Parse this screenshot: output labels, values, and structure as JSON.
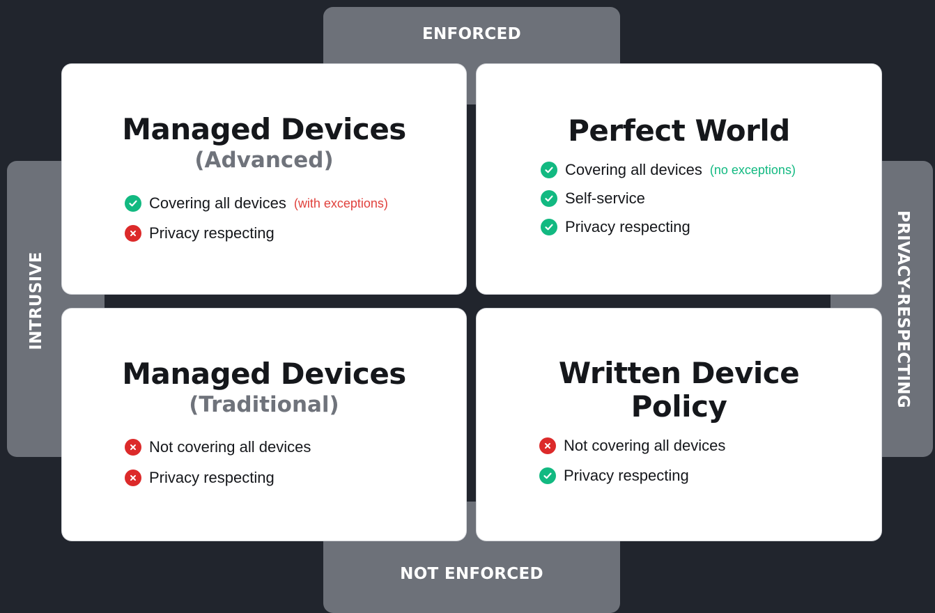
{
  "colors": {
    "background": "#21252d",
    "band": "#6d7179",
    "card": "#ffffff",
    "check": "#12b981",
    "cross": "#dc2a2a",
    "note_red": "#e0413c",
    "note_green": "#12b981"
  },
  "axes": {
    "top": "ENFORCED",
    "bottom": "NOT ENFORCED",
    "left": "INTRUSIVE",
    "right": "PRIVACY-RESPECTING"
  },
  "quadrants": {
    "top_left": {
      "title": "Managed Devices",
      "subtitle": "(Advanced)",
      "items": [
        {
          "status": "check",
          "icon": "check-circle-icon",
          "text": "Covering all devices",
          "note": "(with exceptions)"
        },
        {
          "status": "cross",
          "icon": "x-circle-icon",
          "text": "Privacy respecting"
        }
      ]
    },
    "top_right": {
      "title": "Perfect World",
      "items": [
        {
          "status": "check",
          "icon": "check-circle-icon",
          "text": "Covering all devices",
          "note": "(no exceptions)"
        },
        {
          "status": "check",
          "icon": "check-circle-icon",
          "text": "Self-service"
        },
        {
          "status": "check",
          "icon": "check-circle-icon",
          "text": "Privacy respecting"
        }
      ]
    },
    "bottom_left": {
      "title": "Managed Devices",
      "subtitle": "(Traditional)",
      "items": [
        {
          "status": "cross",
          "icon": "x-circle-icon",
          "text": "Not covering all devices"
        },
        {
          "status": "cross",
          "icon": "x-circle-icon",
          "text": "Privacy respecting"
        }
      ]
    },
    "bottom_right": {
      "title_line1": "Written Device",
      "title_line2": "Policy",
      "items": [
        {
          "status": "cross",
          "icon": "x-circle-icon",
          "text": "Not covering all devices"
        },
        {
          "status": "check",
          "icon": "check-circle-icon",
          "text": "Privacy respecting"
        }
      ]
    }
  }
}
